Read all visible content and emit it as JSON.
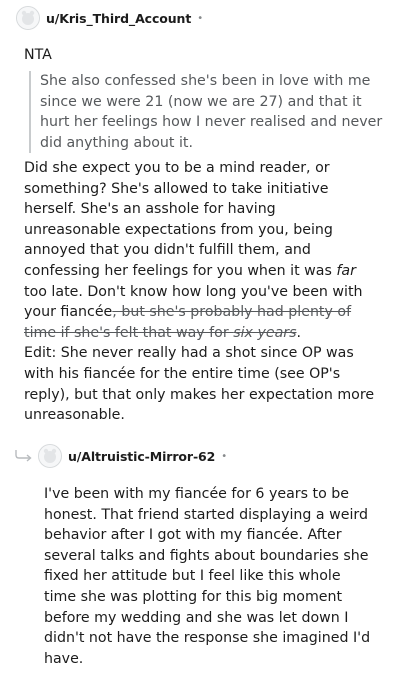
{
  "comments": [
    {
      "username": "u/Kris_Third_Account",
      "separator": "•",
      "verdict": "NTA",
      "quote": "She also confessed she's been in love with me since we were 21 (now we are 27) and that it hurt her feelings how I never realised and never did anything about it.",
      "body_part1": "Did she expect you to be a mind reader, or something? She's allowed to take initiative herself. She's an asshole for having unreasonable expectations from you, being annoyed that you didn't fulfill them, and confessing her feelings for you when it was ",
      "body_emph": "far",
      "body_part2": " too late. Don't know how long you've been with your fiancée",
      "body_strike": ", but she's probably had plenty of time if she's felt that way for ",
      "body_strike_emph": "six years",
      "body_part3": ".",
      "edit": "Edit: She never really had a shot since OP was with his fiancée for the entire time (see OP's reply), but that only makes her expectation more unreasonable."
    },
    {
      "username": "u/Altruistic-Mirror-62",
      "separator": "•",
      "body": "I've been with my fiancée for 6 years to be honest. That friend started displaying a weird behavior after I got with my fiancée. After several talks and fights about boundaries she fixed her attitude but I feel like this whole time she was plotting for this big moment before my wedding and she was let down I didn't not have the response she imagined I'd have."
    }
  ],
  "icons": {
    "avatar": "default-avatar-icon",
    "reply": "reply-arrow-icon"
  },
  "colors": {
    "text": "#1c1c1c",
    "quote_text": "#56595c",
    "quote_bar": "#c8cbcd",
    "muted": "#878a8c"
  }
}
